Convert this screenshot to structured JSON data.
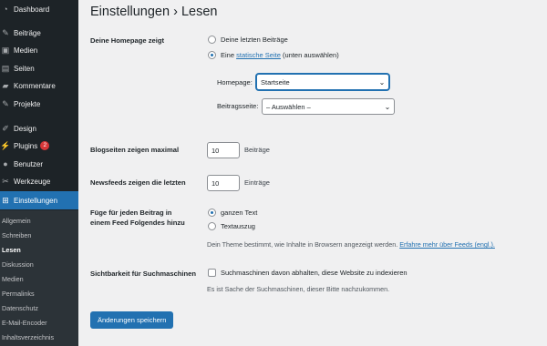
{
  "sidebar": {
    "items": [
      {
        "label": "Dashboard",
        "icon": "dashboard-icon"
      },
      {
        "label": "Beiträge",
        "icon": "pushpin-icon"
      },
      {
        "label": "Medien",
        "icon": "media-icon"
      },
      {
        "label": "Seiten",
        "icon": "pages-icon"
      },
      {
        "label": "Kommentare",
        "icon": "comments-icon"
      },
      {
        "label": "Projekte",
        "icon": "pushpin-icon"
      },
      {
        "label": "Design",
        "icon": "brush-icon"
      },
      {
        "label": "Plugins",
        "icon": "plugin-icon",
        "badge": "2"
      },
      {
        "label": "Benutzer",
        "icon": "user-icon"
      },
      {
        "label": "Werkzeuge",
        "icon": "wrench-icon"
      },
      {
        "label": "Einstellungen",
        "icon": "settings-icon"
      }
    ],
    "submenu": [
      "Allgemein",
      "Schreiben",
      "Lesen",
      "Diskussion",
      "Medien",
      "Permalinks",
      "Datenschutz",
      "E-Mail-Encoder",
      "Inhaltsverzeichnis"
    ]
  },
  "page": {
    "title": "Einstellungen › Lesen"
  },
  "homepage": {
    "label": "Deine Homepage zeigt",
    "option_latest": "Deine letzten Beiträge",
    "option_static_prefix": "Eine",
    "option_static_link": "statische Seite",
    "option_static_suffix": "(unten auswählen)",
    "homepage_label": "Homepage:",
    "homepage_value": "Startseite",
    "posts_label": "Beitragsseite:",
    "posts_value": "– Auswählen –"
  },
  "blog_pages": {
    "label": "Blogseiten zeigen maximal",
    "value": "10",
    "unit": "Beiträge"
  },
  "feeds": {
    "label": "Newsfeeds zeigen die letzten",
    "value": "10",
    "unit": "Einträge"
  },
  "feed_content": {
    "label_line1": "Füge für jeden Beitrag in",
    "label_line2": "einem Feed Folgendes hinzu",
    "option_full": "ganzen Text",
    "option_excerpt": "Textauszug",
    "description": "Dein Theme bestimmt, wie Inhalte in Browsern angezeigt werden.",
    "learn_more": "Erfahre mehr über Feeds (engl.)."
  },
  "visibility": {
    "label": "Sichtbarkeit für Suchmaschinen",
    "checkbox_label": "Suchmaschinen davon abhalten, diese Website zu indexieren",
    "description": "Es ist Sache der Suchmaschinen, dieser Bitte nachzukommen."
  },
  "save_button": "Änderungen speichern",
  "colors": {
    "accent": "#2271b1",
    "sidebar": "#1d2327",
    "badge": "#d63638"
  }
}
